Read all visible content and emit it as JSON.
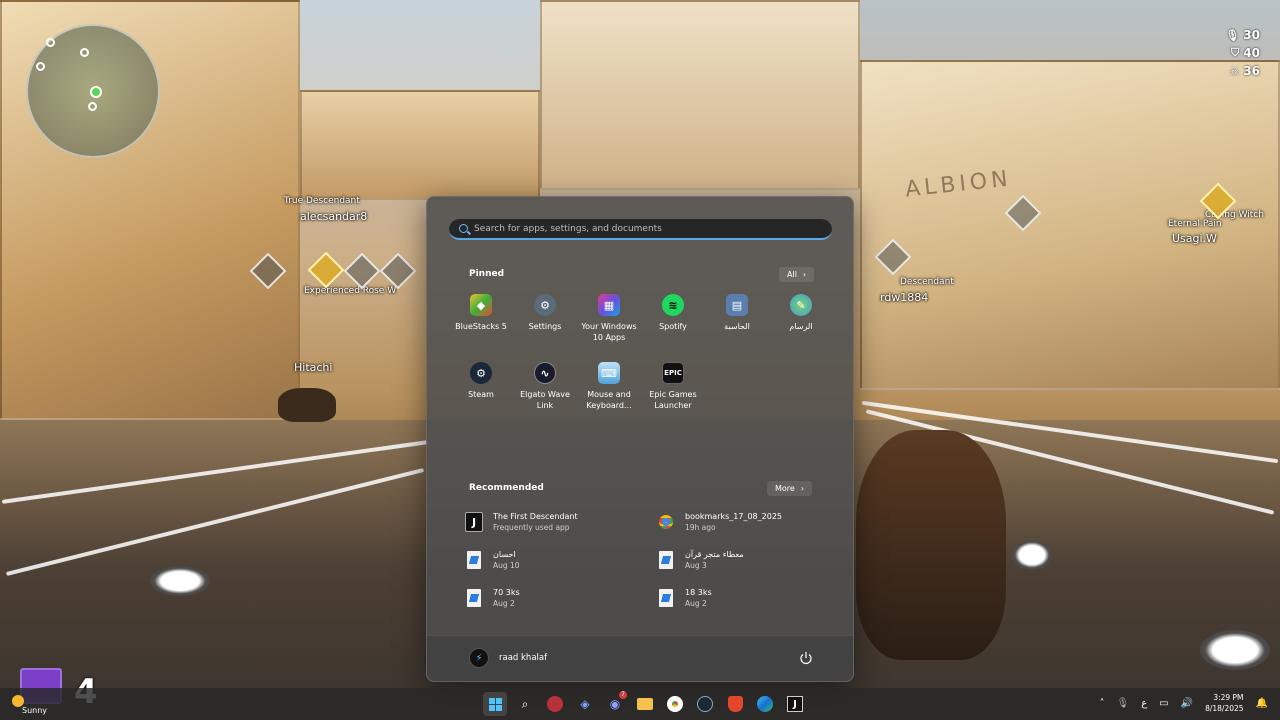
{
  "game_hud": {
    "counters": [
      {
        "icon": "microphone-icon",
        "value": "30"
      },
      {
        "icon": "shield-icon",
        "value": "40"
      },
      {
        "icon": "skull-icon",
        "value": "36"
      }
    ],
    "world_label": "ALBION",
    "player_tags": [
      {
        "text": "True Descendant"
      },
      {
        "text": "alecsandar8"
      },
      {
        "text": "Experienced Rose W"
      },
      {
        "text": "Hitachi"
      },
      {
        "text": "Eternal Pain"
      },
      {
        "text": "Usagi.W"
      },
      {
        "text": "Calling Witch"
      },
      {
        "text": "Descendant"
      },
      {
        "text": "rdw1884"
      }
    ],
    "stream_number": "4"
  },
  "start_menu": {
    "search": {
      "placeholder": "Search for apps, settings, and documents"
    },
    "pinned": {
      "title": "Pinned",
      "all_label": "All",
      "apps": [
        {
          "label": "BlueStacks 5",
          "icon": "bluestacks-icon",
          "color": "#3fae3a"
        },
        {
          "label": "Settings",
          "icon": "gear-icon",
          "color": "#5a6b7c"
        },
        {
          "label": "Your Windows 10 Apps",
          "icon": "windows-apps-icon",
          "color": "#6b4fd8"
        },
        {
          "label": "Spotify",
          "icon": "spotify-icon",
          "color": "#1ed760"
        },
        {
          "label": "الحاسبة",
          "icon": "calculator-icon",
          "color": "#5a7fae"
        },
        {
          "label": "الرسام",
          "icon": "paint-icon",
          "color": "#3a9ad9"
        },
        {
          "label": "Steam",
          "icon": "steam-icon",
          "color": "#1b2838"
        },
        {
          "label": "Elgato Wave Link",
          "icon": "elgato-icon",
          "color": "#1a1a2e"
        },
        {
          "label": "Mouse and Keyboard...",
          "icon": "mouse-keyboard-icon",
          "color": "#4fa3d9"
        },
        {
          "label": "Epic Games Launcher",
          "icon": "epic-games-icon",
          "color": "#111111"
        }
      ]
    },
    "recommended": {
      "title": "Recommended",
      "more_label": "More",
      "items": [
        {
          "title": "The First Descendant",
          "subtitle": "Frequently used app",
          "icon": "first-descendant-icon"
        },
        {
          "title": "bookmarks_17_08_2025",
          "subtitle": "19h ago",
          "icon": "chrome-icon"
        },
        {
          "title": "احسان",
          "subtitle": "Aug 10",
          "icon": "image-file-icon"
        },
        {
          "title": "معطاء متجر قرآن",
          "subtitle": "Aug 3",
          "icon": "image-file-icon"
        },
        {
          "title": "70 3ks",
          "subtitle": "Aug 2",
          "icon": "image-file-icon"
        },
        {
          "title": "18 3ks",
          "subtitle": "Aug 2",
          "icon": "image-file-icon"
        }
      ]
    },
    "user": {
      "name": "raad khalaf"
    }
  },
  "taskbar": {
    "weather": {
      "label": "Sunny"
    },
    "apps": [
      {
        "icon": "windows-start-icon"
      },
      {
        "icon": "search-icon"
      },
      {
        "icon": "app-icon"
      },
      {
        "icon": "vpn-icon"
      },
      {
        "icon": "discord-icon",
        "badge": "7"
      },
      {
        "icon": "file-explorer-icon"
      },
      {
        "icon": "chrome-icon"
      },
      {
        "icon": "steam-icon"
      },
      {
        "icon": "brave-icon"
      },
      {
        "icon": "edge-icon"
      },
      {
        "icon": "first-descendant-icon"
      }
    ],
    "tray": {
      "language": "ع",
      "time": "3:29 PM",
      "date": "8/18/2025"
    }
  }
}
